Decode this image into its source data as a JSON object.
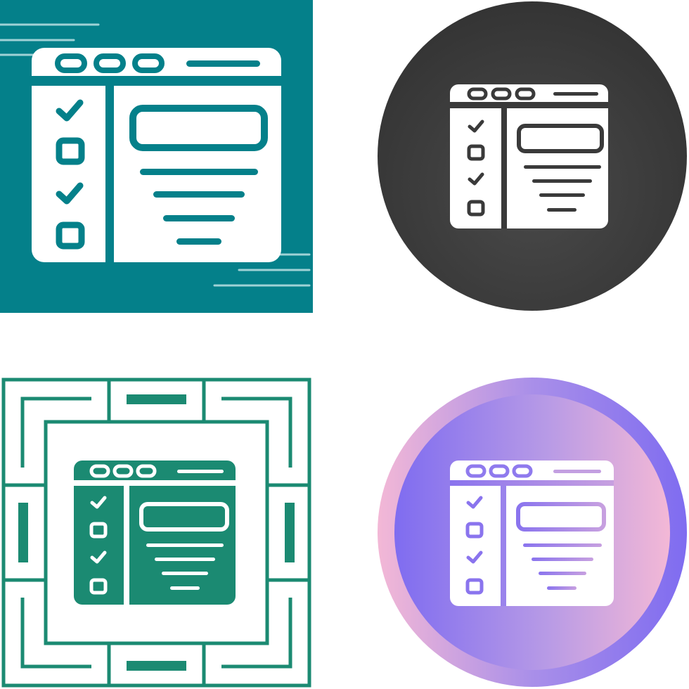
{
  "icons": [
    {
      "name": "checklist-browser-teal-square-icon",
      "style": "teal-square",
      "colors": {
        "bg": "#04808a",
        "fg": "#ffffff"
      }
    },
    {
      "name": "checklist-browser-dark-circle-icon",
      "style": "dark-circle",
      "colors": {
        "bg": "#3a3a3a",
        "fg": "#ffffff"
      }
    },
    {
      "name": "checklist-browser-green-frame-icon",
      "style": "green-frame",
      "colors": {
        "bg": "#ffffff",
        "fg": "#1b8a72"
      }
    },
    {
      "name": "checklist-browser-gradient-circle-icon",
      "style": "gradient-circle",
      "colors": {
        "bg_start": "#f3b8d6",
        "bg_end": "#7f6cf0",
        "fg": "#ffffff"
      }
    }
  ]
}
